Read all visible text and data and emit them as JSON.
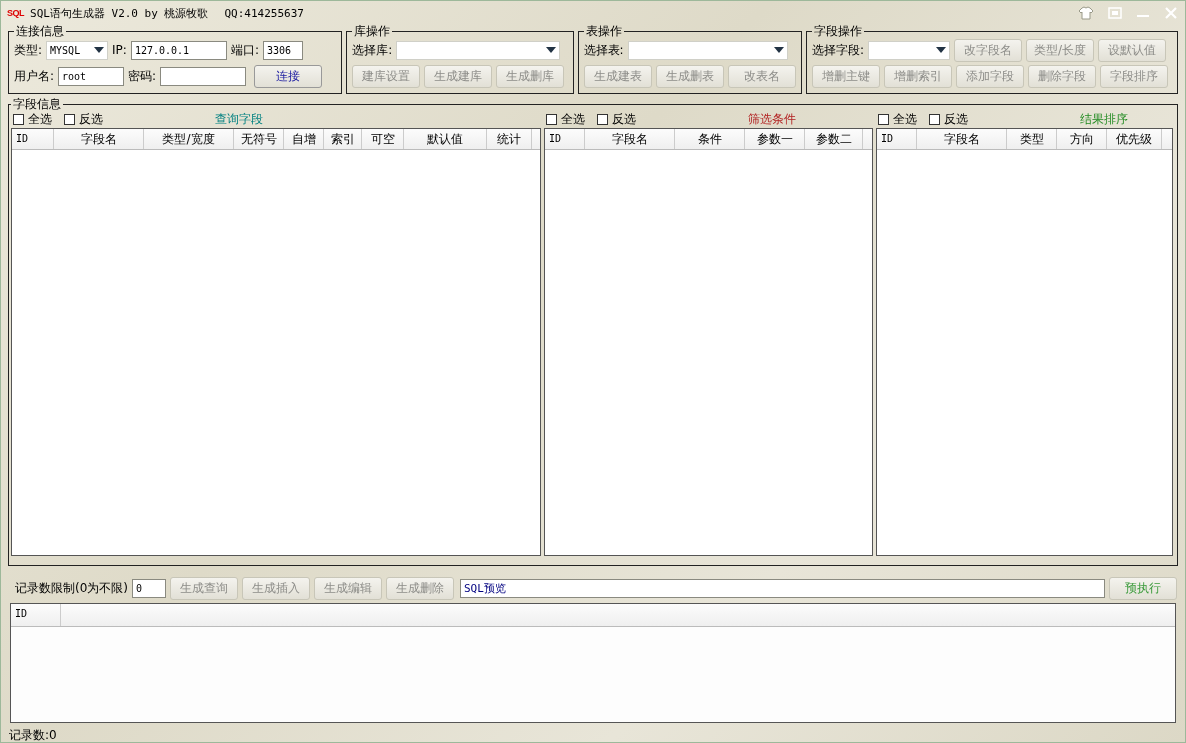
{
  "window": {
    "logo": "SQL",
    "title": "SQL语句生成器 V2.0 by 桃源牧歌",
    "qq": "QQ:414255637"
  },
  "connection": {
    "title": "连接信息",
    "type_label": "类型:",
    "type_value": "MYSQL",
    "ip_label": "IP:",
    "ip_value": "127.0.0.1",
    "port_label": "端口:",
    "port_value": "3306",
    "user_label": "用户名:",
    "user_value": "root",
    "password_label": "密码:",
    "connect_button": {
      "label": "连接",
      "disabled": false
    }
  },
  "db_ops": {
    "title": "库操作",
    "select_label": "选择库:",
    "bottom_buttons": [
      {
        "label": "建库设置",
        "disabled": true
      },
      {
        "label": "生成建库",
        "disabled": true
      },
      {
        "label": "生成删库",
        "disabled": true
      }
    ]
  },
  "table_ops": {
    "title": "表操作",
    "select_label": "选择表:",
    "bottom_buttons": [
      {
        "label": "生成建表",
        "disabled": true
      },
      {
        "label": "生成删表",
        "disabled": true
      },
      {
        "label": "改表名",
        "disabled": true
      }
    ]
  },
  "field_ops": {
    "title": "字段操作",
    "select_label": "选择字段:",
    "top_buttons": [
      {
        "label": "改字段名",
        "disabled": true
      },
      {
        "label": "类型/长度",
        "disabled": true
      },
      {
        "label": "设默认值",
        "disabled": true
      }
    ],
    "bottom_buttons": [
      {
        "label": "增删主键",
        "disabled": true
      },
      {
        "label": "增删索引",
        "disabled": true
      },
      {
        "label": "添加字段",
        "disabled": true
      },
      {
        "label": "删除字段",
        "disabled": true
      },
      {
        "label": "字段排序",
        "disabled": true
      }
    ]
  },
  "fields": {
    "title": "字段信息",
    "panels": [
      {
        "select_all": {
          "label": "全选",
          "checked": false
        },
        "invert": {
          "label": "反选",
          "checked": false
        },
        "heading": "查询字段",
        "kind": "query",
        "columns": [
          "ID",
          "字段名",
          "类型/宽度",
          "无符号",
          "自增",
          "索引",
          "可空",
          "默认值",
          "统计"
        ]
      },
      {
        "select_all": {
          "label": "全选",
          "checked": false
        },
        "invert": {
          "label": "反选",
          "checked": false
        },
        "heading": "筛选条件",
        "kind": "filter",
        "columns": [
          "ID",
          "字段名",
          "条件",
          "参数一",
          "参数二"
        ]
      },
      {
        "select_all": {
          "label": "全选",
          "checked": false
        },
        "invert": {
          "label": "反选",
          "checked": false
        },
        "heading": "结果排序",
        "kind": "sort",
        "columns": [
          "ID",
          "字段名",
          "类型",
          "方向",
          "优先级"
        ]
      }
    ]
  },
  "query_bar": {
    "limit_label": "记录数限制(0为不限)",
    "limit_value": "0",
    "buttons": [
      {
        "label": "生成查询",
        "disabled": true
      },
      {
        "label": "生成插入",
        "disabled": true
      },
      {
        "label": "生成编辑",
        "disabled": true
      },
      {
        "label": "生成删除",
        "disabled": true
      }
    ],
    "sql_preview": "SQL预览",
    "run_button": {
      "label": "预执行",
      "disabled": false
    }
  },
  "results": {
    "columns": [
      "ID"
    ]
  },
  "status_bar": "记录数:0"
}
